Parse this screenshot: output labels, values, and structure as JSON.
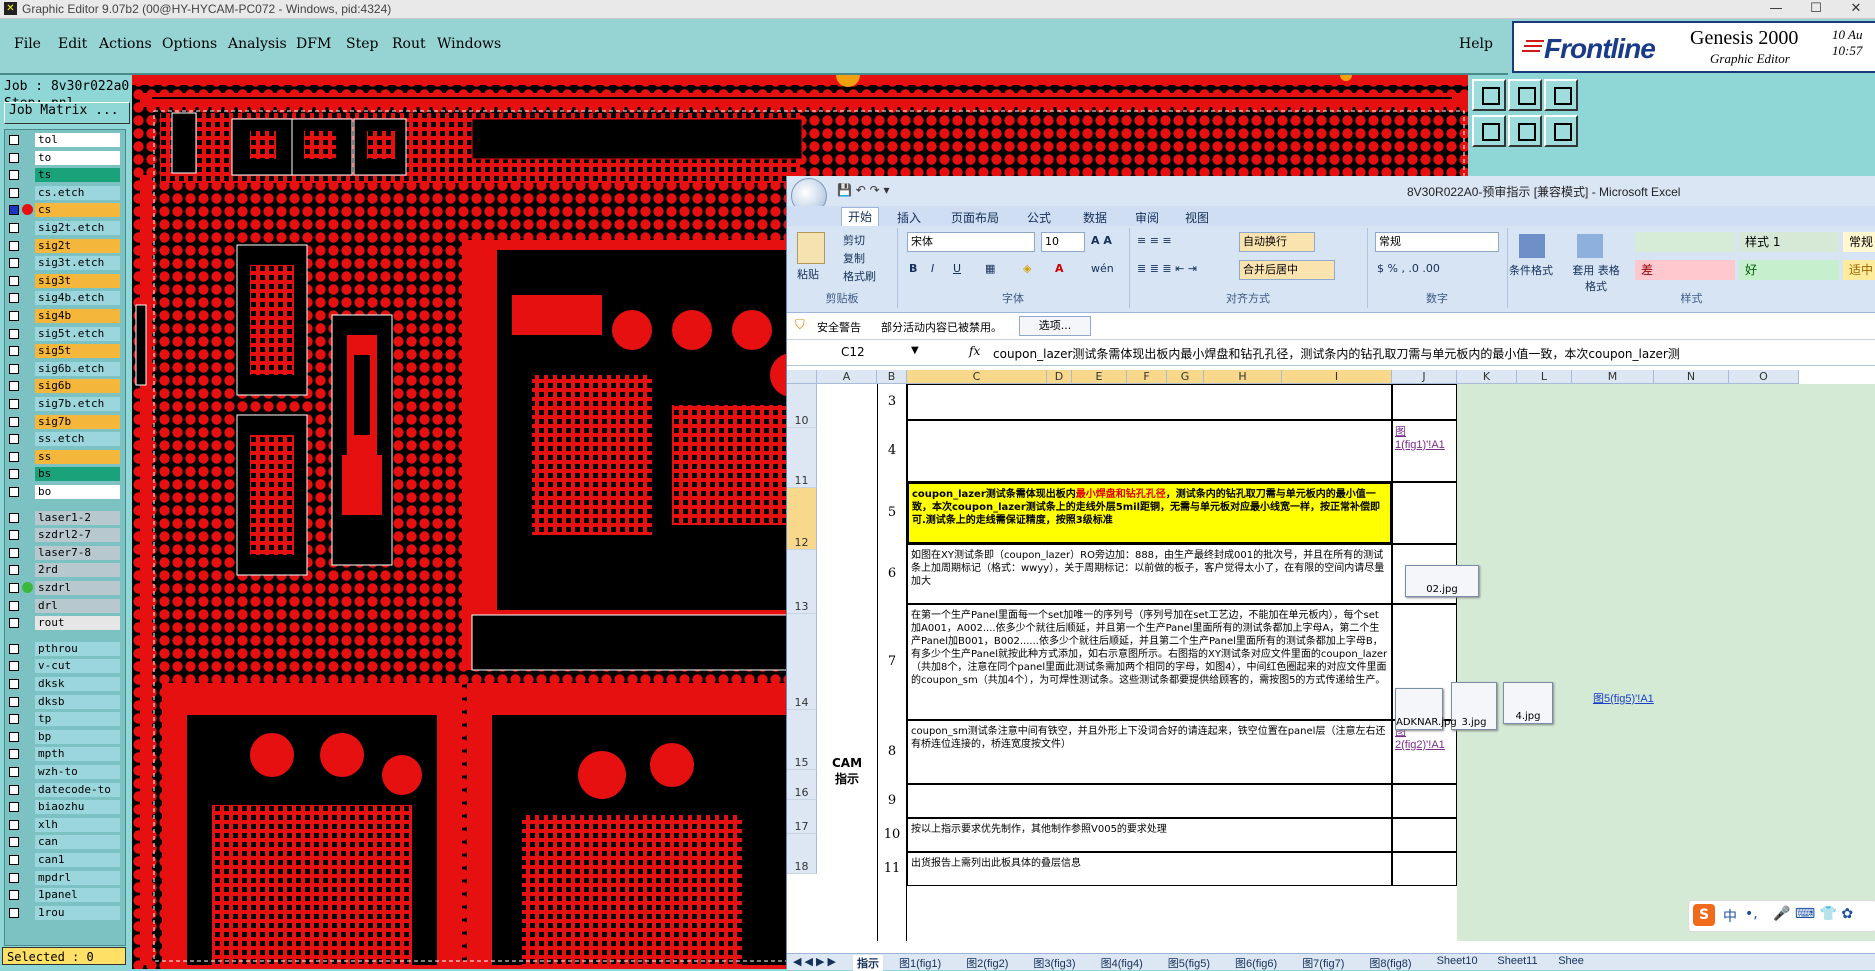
{
  "titlebar": {
    "title": "Graphic Editor 9.07b2 (00@HY-HYCAM-PC072 - Windows, pid:4324)",
    "min": "—",
    "max": "☐",
    "close": "✕"
  },
  "menu": {
    "file": "File",
    "edit": "Edit",
    "actions": "Actions",
    "options": "Options",
    "analysis": "Analysis",
    "dfm": "DFM",
    "step": "Step",
    "rout": "Rout",
    "windows": "Windows",
    "help": "Help"
  },
  "brand": {
    "logo": "Frontline",
    "product": "Genesis 2000",
    "subtitle": "Graphic Editor",
    "time1": "10 Au",
    "time2": "10:57"
  },
  "job": {
    "job_line": "Job : 8v30r022a0",
    "step_line": "Step: pnl",
    "matrix_button": "Job Matrix ..."
  },
  "layers": [
    {
      "name": "tol",
      "color": "#ffffff"
    },
    {
      "name": "to",
      "color": "#ffffff"
    },
    {
      "name": "ts",
      "color": "#1aa37a"
    },
    {
      "name": "cs.etch",
      "color": "#9ad6dc"
    },
    {
      "name": "cs",
      "color": "#f5b63c"
    },
    {
      "name": "sig2t.etch",
      "color": "#9ad6dc"
    },
    {
      "name": "sig2t",
      "color": "#f5b63c"
    },
    {
      "name": "sig3t.etch",
      "color": "#9ad6dc"
    },
    {
      "name": "sig3t",
      "color": "#f5b63c"
    },
    {
      "name": "sig4b.etch",
      "color": "#9ad6dc"
    },
    {
      "name": "sig4b",
      "color": "#f5b63c"
    },
    {
      "name": "sig5t.etch",
      "color": "#9ad6dc"
    },
    {
      "name": "sig5t",
      "color": "#f5b63c"
    },
    {
      "name": "sig6b.etch",
      "color": "#9ad6dc"
    },
    {
      "name": "sig6b",
      "color": "#f5b63c"
    },
    {
      "name": "sig7b.etch",
      "color": "#9ad6dc"
    },
    {
      "name": "sig7b",
      "color": "#f5b63c"
    },
    {
      "name": "ss.etch",
      "color": "#9ad6dc"
    },
    {
      "name": "ss",
      "color": "#f5b63c"
    },
    {
      "name": "bs",
      "color": "#1aa37a"
    },
    {
      "name": "bo",
      "color": "#ffffff"
    },
    {
      "name": "laser1-2",
      "color": "#b7c9cf"
    },
    {
      "name": "szdrl2-7",
      "color": "#b7c9cf"
    },
    {
      "name": "laser7-8",
      "color": "#b7c9cf"
    },
    {
      "name": "2rd",
      "color": "#b7c9cf"
    },
    {
      "name": "szdrl",
      "color": "#b7c9cf"
    },
    {
      "name": "drl",
      "color": "#b7c9cf"
    },
    {
      "name": "rout",
      "color": "#e6e6e6"
    },
    {
      "name": "pthrou",
      "color": "#9ad6dc"
    },
    {
      "name": "v-cut",
      "color": "#9ad6dc"
    },
    {
      "name": "dksk",
      "color": "#9ad6dc"
    },
    {
      "name": "dksb",
      "color": "#9ad6dc"
    },
    {
      "name": "tp",
      "color": "#9ad6dc"
    },
    {
      "name": "bp",
      "color": "#9ad6dc"
    },
    {
      "name": "mpth",
      "color": "#9ad6dc"
    },
    {
      "name": "wzh-to",
      "color": "#9ad6dc"
    },
    {
      "name": "datecode-to",
      "color": "#9ad6dc"
    },
    {
      "name": "biaozhu",
      "color": "#9ad6dc"
    },
    {
      "name": "xlh",
      "color": "#9ad6dc"
    },
    {
      "name": "can",
      "color": "#9ad6dc"
    },
    {
      "name": "can1",
      "color": "#9ad6dc"
    },
    {
      "name": "mpdrl",
      "color": "#9ad6dc"
    },
    {
      "name": "1panel",
      "color": "#9ad6dc"
    },
    {
      "name": "1rou",
      "color": "#9ad6dc"
    }
  ],
  "selected": "Selected : 0",
  "excel": {
    "title": "8V30R022A0-预审指示 [兼容模式] - Microsoft Excel",
    "tabs": [
      "开始",
      "插入",
      "页面布局",
      "公式",
      "数据",
      "审阅",
      "视图"
    ],
    "ribbon": {
      "paste": "粘贴",
      "cut": "剪切",
      "copy": "复制",
      "format_painter": "格式刷",
      "clipboard": "剪贴板",
      "font_name": "宋体",
      "font_size": "10",
      "font_group": "字体",
      "wrap": "自动换行",
      "merge": "合并后居中",
      "align_group": "对齐方式",
      "number_format": "常规",
      "number_group": "数字",
      "cond_format": "条件格式",
      "table_format": "套用 表格格式",
      "style_group": "样式",
      "style1": "样式 1",
      "bad": "差",
      "good": "好",
      "normal": "常规",
      "neutral": "适中"
    },
    "security": {
      "label": "安全警告",
      "msg": "部分活动内容已被禁用。",
      "options": "选项..."
    },
    "namebox": "C12",
    "fx": "fx",
    "formula": "coupon_lazer测试条需体现出板内最小焊盘和钻孔孔径，测试条内的钻孔取刀需与单元板内的最小值一致，本次coupon_lazer测",
    "columns": [
      "A",
      "B",
      "C",
      "D",
      "E",
      "F",
      "G",
      "H",
      "I",
      "J",
      "K",
      "L",
      "M",
      "N",
      "O"
    ],
    "rows": [
      "10",
      "11",
      "12",
      "13",
      "14",
      "15",
      "16",
      "17",
      "18"
    ],
    "section": "CAM\n指示",
    "items": [
      {
        "no": "3",
        "text": "",
        "link": ""
      },
      {
        "no": "4",
        "text": "",
        "link": "图1(fig1)'!A1"
      },
      {
        "no": "5",
        "text_pre": "coupon_lazer测试条需体现出板内",
        "text_red": "最小焊盘和钻孔孔径",
        "text_post": "，测试条内的钻孔取刀需与单元板内的最小值一致，本次coupon_lazer测试条上的走线外层5mil距铜，无需与单元板对应最小线宽一样，按正常补偿即可.测试条上的走线需保证精度，按照3级标准",
        "link": ""
      },
      {
        "no": "6",
        "text": "如图在XY测试条即（coupon_lazer）RO旁边加：888，由生产最终封成001的批次号，并且在所有的测试条上加周期标记（格式：wwyy），关于周期标记：以前做的板子，客户觉得太小了，在有限的空间内请尽量加大",
        "link": ""
      },
      {
        "no": "7",
        "text": "在第一个生产Panel里面每一个set加唯一的序列号（序列号加在set工艺边，不能加在单元板内），每个set加A001，A002....依多少个就往后顺延，并且第一个生产Panel里面所有的测试条都加上字母A，第二个生产Panel加B001，B002......依多少个就往后顺延，并且第二个生产Panel里面所有的测试条都加上字母B，有多少个生产Panel就按此种方式添加，如右示意图所示。右图指的XY测试条对应文件里面的coupon_lazer（共加8个，注意在同个panel里面此测试条需加两个相同的字母，如图4），中间红色圈起来的对应文件里面的coupon_sm（共加4个），为可焊性测试条。这些测试条都要提供给顾客的，需按图5的方式传递给生产。",
        "link": "图5(fig5)'!A1"
      },
      {
        "no": "8",
        "text": "coupon_sm测试条注意中间有铁空，并且外形上下没词合好的请连起来，铁空位置在panel层（注意左右还有桥连位连接的，桥连宽度按文件）",
        "link": "图2(fig2)'!A1"
      },
      {
        "no": "9",
        "text": "",
        "link": ""
      },
      {
        "no": "10",
        "text": "按以上指示要求优先制作，其他制作参照V005的要求处理",
        "link": ""
      },
      {
        "no": "11",
        "text": "出货报告上需列出此板具体的叠层信息",
        "link": ""
      }
    ],
    "images": [
      "02.jpg",
      "3.jpg",
      "4.jpg",
      "ADKNAR.jpg"
    ],
    "sheets": [
      "指示",
      "图1(fig1)",
      "图2(fig2)",
      "图3(fig3)",
      "图4(fig4)",
      "图5(fig5)",
      "图6(fig6)",
      "图7(fig7)",
      "图8(fig8)",
      "Sheet10",
      "Sheet11",
      "Shee"
    ]
  },
  "ime": {
    "lang": "中",
    "dot": "•,"
  }
}
